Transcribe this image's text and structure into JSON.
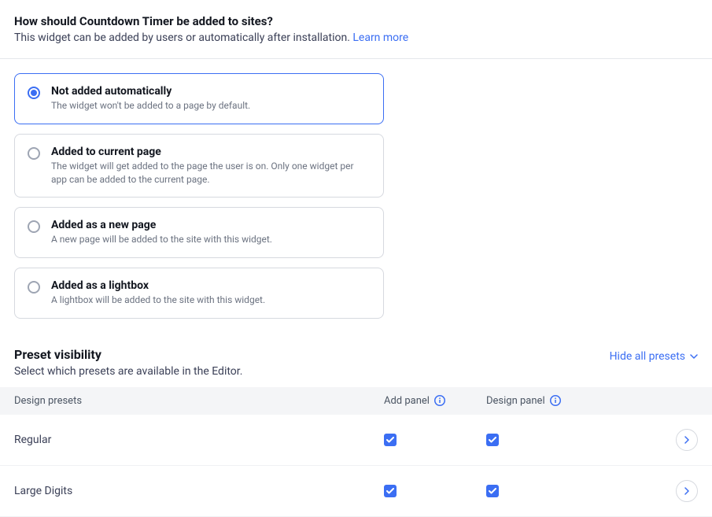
{
  "header": {
    "title": "How should Countdown Timer be added to sites?",
    "subtitle": "This widget can be added by users or automatically after installation. ",
    "learn_more": "Learn more"
  },
  "options": [
    {
      "title": "Not added automatically",
      "desc": "The widget won't be added to a page by default.",
      "selected": true
    },
    {
      "title": "Added to current page",
      "desc": "The widget will get added to the page the user is on. Only one widget per app can be added to the current page.",
      "selected": false
    },
    {
      "title": "Added as a new page",
      "desc": "A new page will be added to the site with this widget.",
      "selected": false
    },
    {
      "title": "Added as a lightbox",
      "desc": "A lightbox will be added to the site with this widget.",
      "selected": false
    }
  ],
  "presets": {
    "title": "Preset visibility",
    "subtitle": "Select which presets are available in the Editor.",
    "hide_all": "Hide all presets",
    "columns": {
      "name": "Design presets",
      "add": "Add panel",
      "design": "Design panel"
    },
    "rows": [
      {
        "name": "Regular",
        "add": true,
        "design": true
      },
      {
        "name": "Large Digits",
        "add": true,
        "design": true
      }
    ]
  }
}
